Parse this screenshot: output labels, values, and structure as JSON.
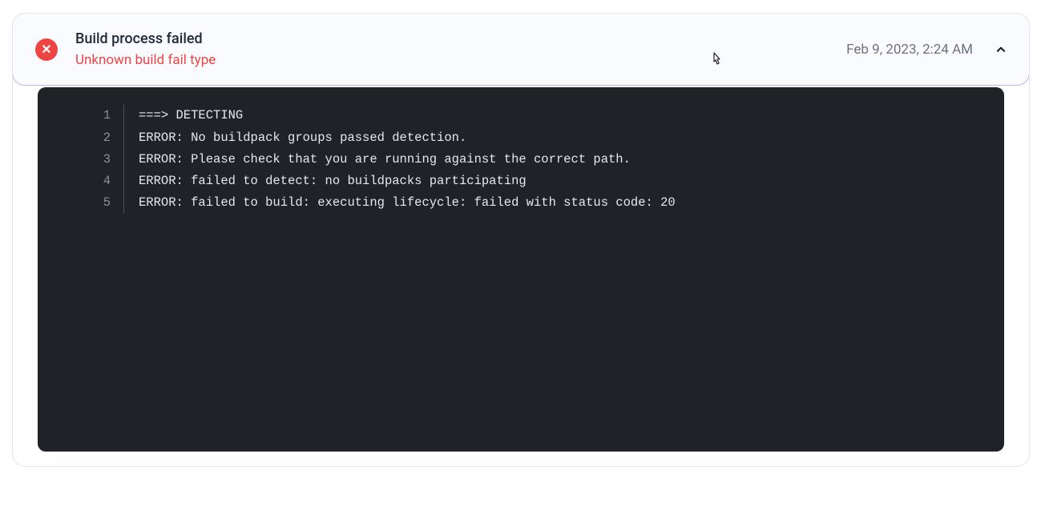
{
  "panel": {
    "title": "Build process failed",
    "subtitle": "Unknown build fail type",
    "timestamp": "Feb 9, 2023, 2:24 AM"
  },
  "log": {
    "lines": [
      {
        "n": "1",
        "text": "===> DETECTING"
      },
      {
        "n": "2",
        "text": "ERROR: No buildpack groups passed detection."
      },
      {
        "n": "3",
        "text": "ERROR: Please check that you are running against the correct path."
      },
      {
        "n": "4",
        "text": "ERROR: failed to detect: no buildpacks participating"
      },
      {
        "n": "5",
        "text": "ERROR: failed to build: executing lifecycle: failed with status code: 20"
      }
    ]
  },
  "colors": {
    "error": "#ef4444",
    "panel_bg": "#fafbff",
    "code_bg": "#1f2328",
    "panel_border": "#b8b6f7"
  }
}
